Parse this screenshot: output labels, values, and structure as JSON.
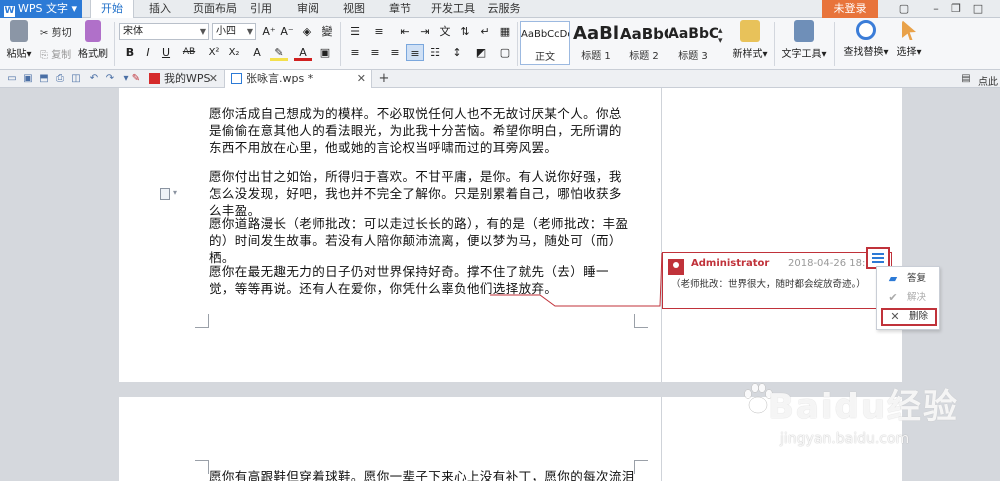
{
  "title_bar": {
    "app_menu": "WPS 文字",
    "tabs": [
      "开始",
      "插入",
      "页面布局",
      "引用",
      "审阅",
      "视图",
      "章节",
      "开发工具",
      "云服务"
    ],
    "login": "未登录"
  },
  "ribbon": {
    "paste": "粘贴",
    "cut": "剪切",
    "copy": "复制",
    "format_painter": "格式刷",
    "font_name": "宋体",
    "font_size": "小四",
    "styles": [
      {
        "sample": "AaBbCcDd",
        "label": "正文"
      },
      {
        "sample": "AaBl",
        "label": "标题 1"
      },
      {
        "sample": "AaBbC",
        "label": "标题 2"
      },
      {
        "sample": "AaBbC",
        "label": "标题 3"
      }
    ],
    "new_style": "新样式",
    "text_tools": "文字工具",
    "find_replace": "查找替换",
    "select": "选择"
  },
  "doc_tabs": {
    "my_wps": "我的WPS",
    "active_doc": "张咏言.wps *",
    "right_label": "点此"
  },
  "document": {
    "paragraphs": [
      "愿你活成自己想成为的模样。不必取悦任何人也不无故讨厌某个人。你总是偷偷在意其他人的看法眼光，为此我十分苦恼。希望你明白，无所谓的东西不用放在心里，他或她的言论权当呼啸而过的耳旁风罢。",
      "愿你付出甘之如饴，所得归于喜欢。不甘平庸，是你。有人说你好强，我怎么没发现，好吧，我也并不完全了解你。只是别累着自己，哪怕收获多么丰盈。",
      "愿你道路漫长（老师批改：可以走过长长的路），有的是（老师批改：丰盈的）时间发生故事。若没有人陪你颠沛流离，便以梦为马，随处可（而）栖。",
      "愿你在最无趣无力的日子仍对世界保持好奇。撑不住了就先（去）睡一觉，等等再说。还有人在爱你，你凭什么辜负他们选择放弃。"
    ],
    "page2_paragraph": "愿你有高跟鞋但穿着球鞋。愿你一辈子下来心上没有补丁，愿你的每次流泪都是"
  },
  "comment": {
    "author": "Administrator",
    "time": "2018-04-26 18:13",
    "text": "（老师批改：世界很大，随时都会绽放奇迹。）"
  },
  "context_menu": {
    "reply": "答复",
    "resolve": "解决",
    "delete": "删除"
  },
  "watermark": {
    "brand": "Baidu经验",
    "url": "jingyan.baidu.com"
  },
  "colors": {
    "accent": "#2c7ad6",
    "comment_red": "#c0323a",
    "login_orange": "#e8743b"
  }
}
